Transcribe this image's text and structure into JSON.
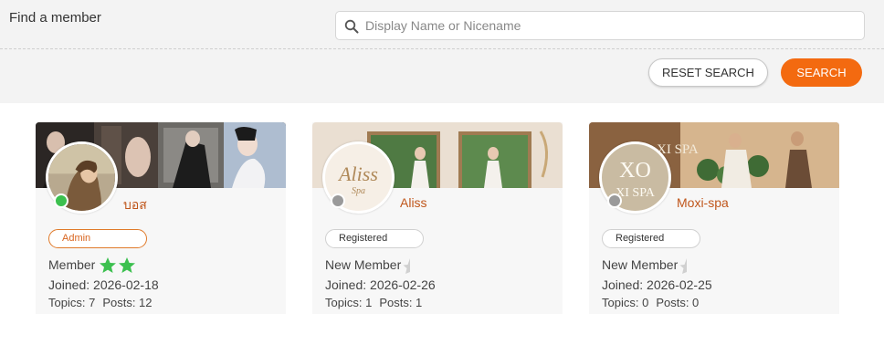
{
  "search": {
    "label": "Find a member",
    "placeholder": "Display Name or Nicename",
    "reset_label": "RESET SEARCH",
    "search_label": "SEARCH"
  },
  "colors": {
    "accent": "#f36a10",
    "online": "#3cc04f",
    "offline": "#9a9a9a",
    "name": "#c0561b"
  },
  "members": [
    {
      "name": "บอส",
      "status": "online",
      "role": "Admin",
      "rank": "Member",
      "rank_icons": [
        "star-icon",
        "star-icon"
      ],
      "joined": "Joined: 2026-02-18",
      "topics": "Topics: 7",
      "posts": "Posts: 12"
    },
    {
      "name": "Aliss",
      "status": "offline",
      "role": "Registered",
      "rank": "New Member",
      "rank_icons": [
        "half-star-icon"
      ],
      "joined": "Joined: 2026-02-26",
      "topics": "Topics: 1",
      "posts": "Posts: 1",
      "avatar_text": "Aliss",
      "avatar_subtext": "Spa"
    },
    {
      "name": "Moxi-spa",
      "status": "offline",
      "role": "Registered",
      "rank": "New Member",
      "rank_icons": [
        "half-star-icon"
      ],
      "joined": "Joined: 2026-02-25",
      "topics": "Topics: 0",
      "posts": "Posts: 0",
      "avatar_text": "XO",
      "avatar_subtext": "XI SPA",
      "cover_text": "XI SPA"
    }
  ]
}
